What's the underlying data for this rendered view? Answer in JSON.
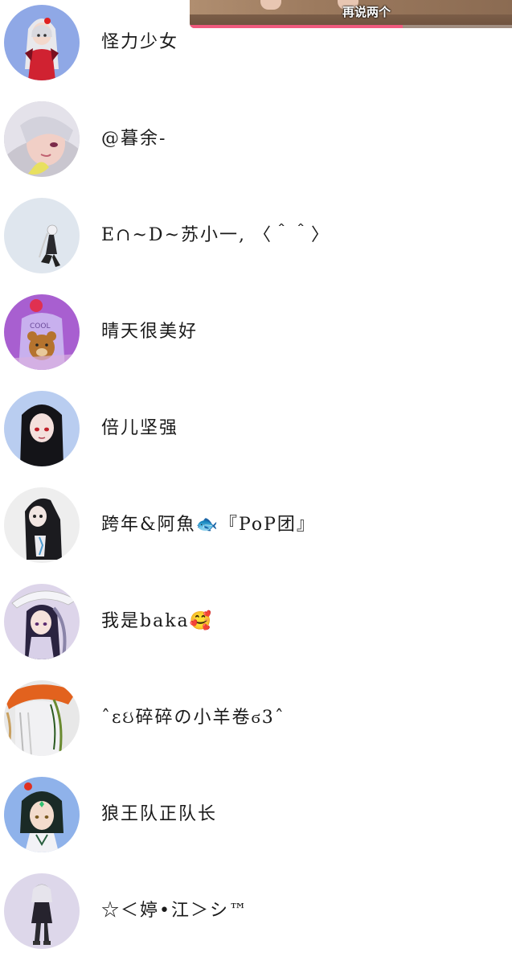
{
  "video_overlay": {
    "subtitle": "再说两个",
    "progress_fraction": 0.66,
    "progress_color": "#f05a7e"
  },
  "users": [
    {
      "name": "怪力少女",
      "avatar_icon": "avatar-icon-white-haired-girl-red-dress",
      "avatar_bg": "#8fa8e6"
    },
    {
      "name": "@暮余-",
      "avatar_icon": "avatar-icon-silver-haired-girl",
      "avatar_bg": "#c9c6cf"
    },
    {
      "name": "E∩~D~苏小一, 〈＾＾〉",
      "avatar_icon": "avatar-icon-small-dark-figure",
      "avatar_bg": "#dfe6ee"
    },
    {
      "name": "晴天很美好",
      "avatar_icon": "avatar-icon-bear-hoodie",
      "avatar_bg": "#a85fd0"
    },
    {
      "name": "倍儿坚强",
      "avatar_icon": "avatar-icon-black-haired-girl",
      "avatar_bg": "#b9cdf0"
    },
    {
      "name": "跨年&阿魚🐟『PoP团』",
      "avatar_icon": "avatar-icon-black-hooded-chibi",
      "avatar_bg": "#eeeeee"
    },
    {
      "name": "我是baka🥰",
      "avatar_icon": "avatar-icon-umbrella-girl",
      "avatar_bg": "#ddd5ea"
    },
    {
      "name": "ˆεઇ碎碎の小羊卷ϭ3ˆ",
      "avatar_icon": "avatar-icon-orange-hat-character",
      "avatar_bg": "#e8e8e8"
    },
    {
      "name": "狼王队正队长",
      "avatar_icon": "avatar-icon-green-haired-boy",
      "avatar_bg": "#8fb2ea"
    },
    {
      "name": "☆＜婷•江＞シ™",
      "avatar_icon": "avatar-icon-standing-chibi",
      "avatar_bg": "#ddd7ea"
    }
  ]
}
